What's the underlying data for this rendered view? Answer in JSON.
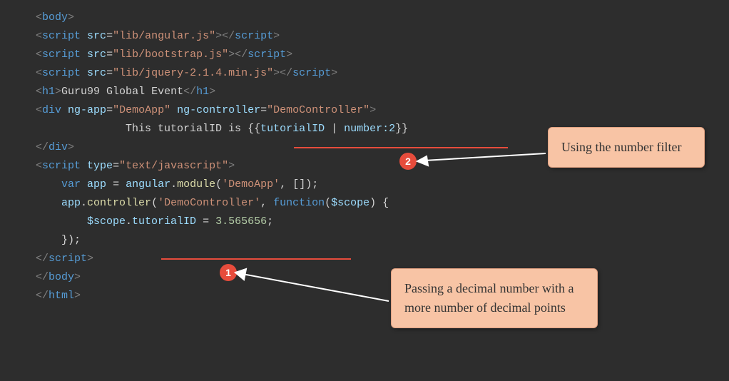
{
  "code": {
    "line1_tag": "body",
    "line2_tag": "script",
    "line2_attr": "src",
    "line2_val": "\"lib/angular.js\"",
    "line2_close": "script",
    "line3_tag": "script",
    "line3_attr": "src",
    "line3_val": "\"lib/bootstrap.js\"",
    "line3_close": "script",
    "line4_tag": "script",
    "line4_attr": "src",
    "line4_val": "\"lib/jquery-2.1.4.min.js\"",
    "line4_close": "script",
    "line5_tag": "h1",
    "line5_text": "Guru99 Global Event",
    "line5_close": "h1",
    "line6_tag": "div",
    "line6_attr1": "ng-app",
    "line6_val1": "\"DemoApp\"",
    "line6_attr2": "ng-controller",
    "line6_val2": "\"DemoController\"",
    "line7_text": "This tutorialID is ",
    "line7_expr_var": "tutorialID",
    "line7_expr_filter": "number:2",
    "line8_close": "div",
    "line9_tag": "script",
    "line9_attr": "type",
    "line9_val": "\"text/javascript\"",
    "line10_var": "var",
    "line10_name": "app",
    "line10_obj": "angular",
    "line10_method": "module",
    "line10_str": "'DemoApp'",
    "line11_obj": "app",
    "line11_method": "controller",
    "line11_str": "'DemoController'",
    "line11_func": "function",
    "line11_param": "$scope",
    "line12_obj": "$scope",
    "line12_prop": "tutorialID",
    "line12_val": "3.565656",
    "line14_close": "script",
    "line15_close": "body",
    "line16_close": "html"
  },
  "badges": {
    "b1": "1",
    "b2": "2"
  },
  "callouts": {
    "c1": "Using the number filter",
    "c2": "Passing a decimal number with a more number of decimal points"
  }
}
